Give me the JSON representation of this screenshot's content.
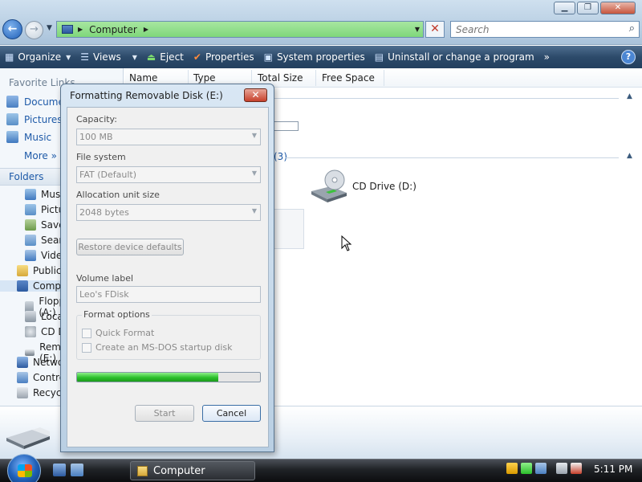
{
  "window": {
    "address_segment": "Computer",
    "search_placeholder": "Search",
    "controls": {
      "minimize": "▁",
      "maximize": "❐",
      "close": "✕"
    }
  },
  "toolbar": {
    "organize": "Organize",
    "views": "Views",
    "eject": "Eject",
    "properties": "Properties",
    "system_properties": "System properties",
    "uninstall": "Uninstall or change a program",
    "more": "»",
    "help": "?"
  },
  "navpane": {
    "favorites_title": "Favorite Links",
    "favorites": [
      "Documents",
      "Pictures",
      "Music"
    ],
    "more": "More",
    "folders_title": "Folders",
    "tree": [
      "Music",
      "Pictures",
      "Saved Games",
      "Searches",
      "Videos",
      "Public",
      "Computer",
      "Floppy Disk Drive (A:)",
      "Local Disk (C:)",
      "CD Drive (D:)",
      "Removable Disk (E:)",
      "Network",
      "Control Panel",
      "Recycle Bin"
    ]
  },
  "content": {
    "columns": [
      "Name",
      "Type",
      "Total Size",
      "Free Space"
    ],
    "group_count": "(3)",
    "cd_drive_label": "CD Drive (D:)"
  },
  "taskbar": {
    "task_label": "Computer",
    "clock": "5:11 PM"
  },
  "dialog": {
    "title": "Formatting Removable Disk (E:)",
    "close": "✕",
    "capacity_label": "Capacity:",
    "capacity_value": "100 MB",
    "filesystem_label": "File system",
    "filesystem_value": "FAT (Default)",
    "alloc_label": "Allocation unit size",
    "alloc_value": "2048 bytes",
    "restore_button": "Restore device defaults",
    "volume_label_label": "Volume label",
    "volume_label_value": "Leo's FDisk",
    "format_options_label": "Format options",
    "quick_format": "Quick Format",
    "msdos_disk": "Create an MS-DOS startup disk",
    "progress": 0.77,
    "start_button": "Start",
    "cancel_button": "Cancel"
  }
}
